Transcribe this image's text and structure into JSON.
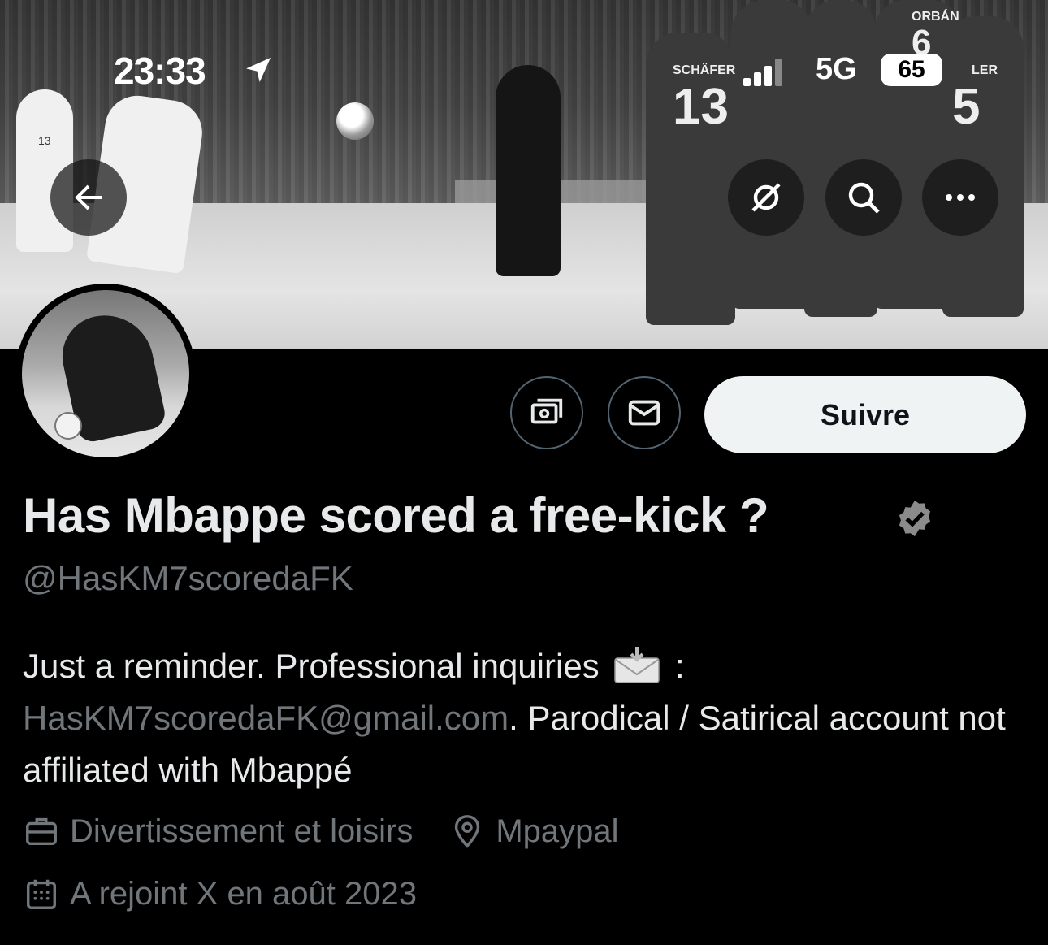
{
  "status_bar": {
    "time": "23:33",
    "network": "5G",
    "battery": "65"
  },
  "profile": {
    "display_name": "Has Mbappe scored a free-kick ?",
    "handle": "@HasKM7scoredaFK",
    "follow_label": "Suivre",
    "bio": {
      "part1": "Just a reminder. Professional inquiries",
      "part1_suffix": " :",
      "email": "HasKM7scoredaFK@gmail.com",
      "part2": ". Parodical / Satirical account not affiliated with Mbappé"
    },
    "category": "Divertissement et loisirs",
    "location": "Mpaypal",
    "joined": "A rejoint X en août 2023"
  },
  "banner_text": {
    "player_left": "13",
    "jersey_13_name": "SCHÄFER",
    "jersey_13_number": "13",
    "jersey_6_name": "ORBÁN",
    "jersey_6_number": "6",
    "jersey_5_name": "LER",
    "jersey_5_number": "5"
  },
  "icons": {
    "back": "arrow-left-icon",
    "grok": "grok-icon",
    "search": "search-icon",
    "more": "more-icon",
    "tip": "money-icon",
    "message": "envelope-icon",
    "verified": "verified-badge-icon",
    "category": "briefcase-icon",
    "location": "location-pin-icon",
    "joined": "calendar-icon"
  }
}
